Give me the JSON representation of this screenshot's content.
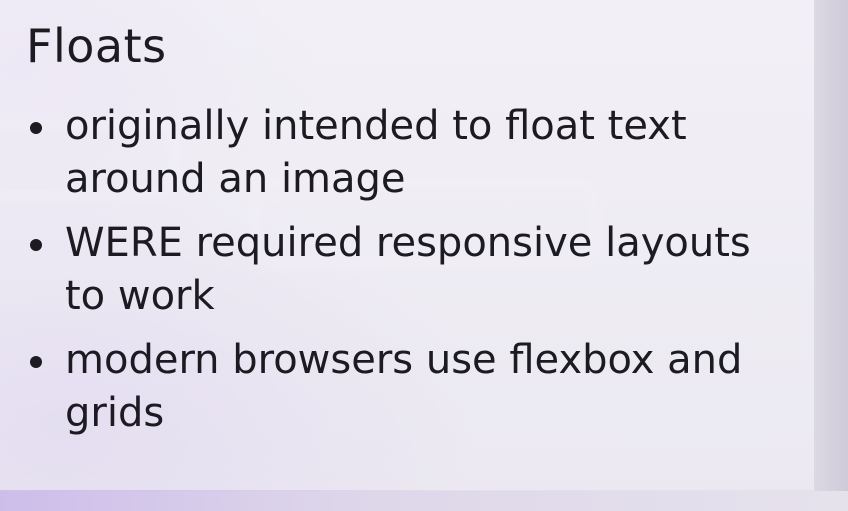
{
  "slide": {
    "title": "Floats",
    "bullets": [
      "originally intended to float text around an image",
      "WERE required responsive layouts to work",
      "modern browsers use flexbox and grids"
    ]
  },
  "colors": {
    "text": "#1c1b22",
    "slide_background": "#f1eff5",
    "backdrop_accent": "#c8b6ea"
  }
}
